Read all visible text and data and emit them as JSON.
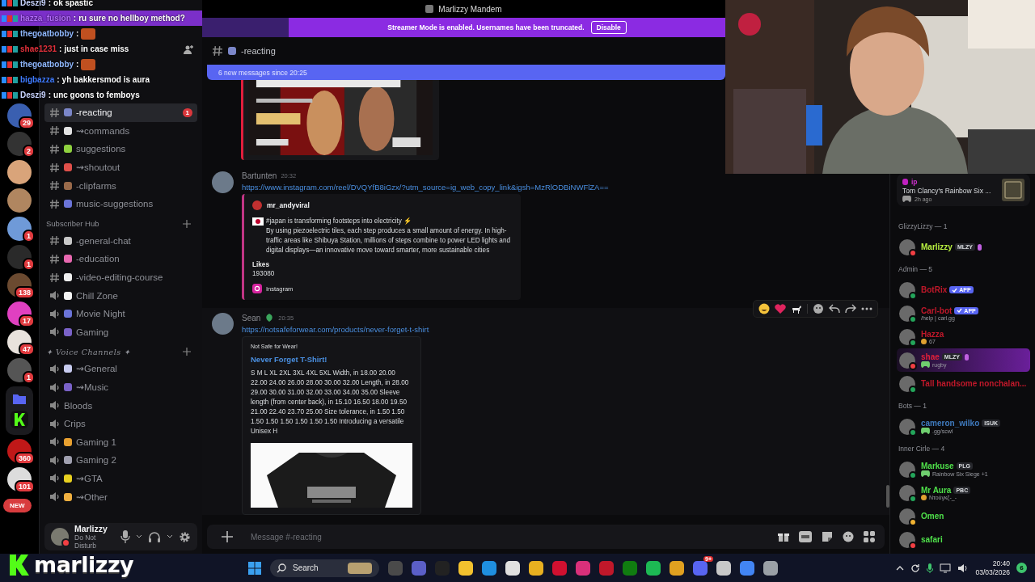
{
  "window": {
    "title": "Marlizzy Mandem"
  },
  "streamer_banner": {
    "text": "Streamer Mode is enabled. Usernames have been truncated.",
    "button": "Disable"
  },
  "stream_chat": [
    {
      "user": "Deszi9",
      "separator": ":",
      "kind": "text",
      "message": "ok spastic",
      "color": "#c9d4ff",
      "highlight": false
    },
    {
      "user": "hazza_fusion",
      "separator": ":",
      "kind": "text",
      "message": "ru sure no hellboy method?",
      "color": "#b46cff",
      "highlight": true
    },
    {
      "user": "thegoatbobby",
      "separator": ":",
      "kind": "emote",
      "color": "#8fb8ff",
      "highlight": false
    },
    {
      "user": "shae1231",
      "separator": ":",
      "kind": "text",
      "message": "just in case miss",
      "color": "#e0303a",
      "highlight": false
    },
    {
      "user": "thegoatbobby",
      "separator": ":",
      "kind": "emote",
      "color": "#8fb8ff",
      "highlight": false
    },
    {
      "user": "bigbazza",
      "separator": ":",
      "kind": "text",
      "message": "yh bakkersmod is aura",
      "color": "#3f7bff",
      "highlight": false
    },
    {
      "user": "Deszi9",
      "separator": ":",
      "kind": "text",
      "message": "unc goons to femboys",
      "color": "#c9d4ff",
      "highlight": false
    }
  ],
  "server_rail": [
    {
      "kind": "server",
      "color": "#3a5fb0",
      "badge": "29"
    },
    {
      "kind": "server",
      "color": "#333333",
      "badge": "2"
    },
    {
      "kind": "server",
      "color": "#d9a47a"
    },
    {
      "kind": "server",
      "color": "#b08660"
    },
    {
      "kind": "server",
      "color": "#6f9ad8",
      "badge": "1"
    },
    {
      "kind": "server",
      "color": "#2a2a2a",
      "badge": "1"
    },
    {
      "kind": "server",
      "color": "#6b4a30",
      "badge": "138"
    },
    {
      "kind": "server",
      "color": "#e040c0",
      "badge": "17"
    },
    {
      "kind": "server",
      "color": "#e8e2dc",
      "badge": "47"
    },
    {
      "kind": "server",
      "color": "#555555",
      "badge": "1"
    },
    {
      "kind": "folder",
      "color": "#5865f2"
    },
    {
      "kind": "server",
      "color": "#c01818",
      "badge": "360"
    },
    {
      "kind": "server",
      "color": "#dcdcdc",
      "badge": "101"
    }
  ],
  "new_badge": "NEW",
  "channel_groups": [
    {
      "channels": [
        {
          "kind": "text",
          "name": "-reacting",
          "color": "#7b86c8",
          "selected": true,
          "badge": "1"
        },
        {
          "kind": "text",
          "name": "⇝commands",
          "color": "#e3e3e3",
          "selected": false
        },
        {
          "kind": "text",
          "name": "suggestions",
          "color": "#8fd13f",
          "selected": false
        },
        {
          "kind": "text",
          "name": "⇝shoutout",
          "color": "#e0504a",
          "selected": false
        },
        {
          "kind": "text",
          "name": "-clipfarms",
          "color": "#9a6a4a",
          "selected": false
        },
        {
          "kind": "text",
          "name": "music-suggestions",
          "color": "#6b74d8",
          "selected": false
        }
      ]
    },
    {
      "title": "Subscriber Hub",
      "channels": [
        {
          "kind": "text",
          "name": "-general-chat",
          "color": "#c8c8c8",
          "selected": false
        },
        {
          "kind": "text",
          "name": "-education",
          "color": "#e868b0",
          "selected": false
        },
        {
          "kind": "text",
          "name": "-video-editing-course",
          "color": "#f0f0f0",
          "selected": false
        },
        {
          "kind": "voice",
          "name": "Chill Zone",
          "color": "#f4f4f4",
          "selected": false
        },
        {
          "kind": "voice",
          "name": "Movie Night",
          "color": "#6b74d8",
          "selected": false
        },
        {
          "kind": "voice",
          "name": "Gaming",
          "color": "#7a62c8",
          "selected": false
        }
      ]
    },
    {
      "title": "✦ Voice Channels ✦",
      "fancy": true,
      "channels": [
        {
          "kind": "voice",
          "name": "⇝General",
          "color": "#c8ccf0",
          "selected": false
        },
        {
          "kind": "voice",
          "name": "⇝Music",
          "color": "#7a62c8",
          "selected": false
        },
        {
          "kind": "voice",
          "name": "Bloods",
          "selected": false
        },
        {
          "kind": "voice",
          "name": "Crips",
          "selected": false
        },
        {
          "kind": "voice",
          "name": "Gaming 1",
          "color": "#e8a030",
          "selected": false
        },
        {
          "kind": "voice",
          "name": "Gaming 2",
          "color": "#a0a0b0",
          "selected": false
        },
        {
          "kind": "voice",
          "name": "⇝GTA",
          "color": "#e8d020",
          "selected": false
        },
        {
          "kind": "voice",
          "name": "⇝Other",
          "color": "#f0b040",
          "selected": false
        }
      ]
    }
  ],
  "user_panel": {
    "name": "Marlizzy",
    "status": "Do Not Disturb"
  },
  "channel_header": {
    "name": "-reacting"
  },
  "new_messages_bar": {
    "text": "6 new messages since 20:25"
  },
  "messages": [
    {
      "kind": "image_embed"
    },
    {
      "kind": "link_embed",
      "author": "Bartunten",
      "time": "20:32",
      "link": "https://www.instagram.com/reel/DVQYfB8iGzx/?utm_source=ig_web_copy_link&igsh=MzRlODBiNWFlZA==",
      "embed": {
        "author": "mr_andyviral",
        "description": "#japan is transforming footsteps into electricity ⚡\nBy using piezoelectric tiles, each step produces a small amount of energy. In high-traffic areas like Shibuya Station, millions of steps combine to power LED lights and digital displays—an innovative move toward smarter, more sustainable cities",
        "field_name": "Likes",
        "field_value": "193080",
        "footer": "Instagram"
      }
    },
    {
      "kind": "product_embed",
      "author": "Sean",
      "time": "20:35",
      "link": "https://notsafeforwear.com/products/never-forget-t-shirt",
      "hovered": true,
      "embed": {
        "provider": "Not Safe for Wear!",
        "title": "Never Forget T-Shirt!",
        "description": "S M L XL 2XL 3XL 4XL 5XL Width, in 18.00 20.00 22.00 24.00 26.00 28.00 30.00 32.00 Length, in 28.00 29.00 30.00 31.00 32.00 33.00 34.00 35.00 Sleeve length (from center back), in 15.10 16.50 18.00 19.50 21.00 22.40 23.70 25.00 Size tolerance, in 1.50 1.50 1.50 1.50 1.50 1.50 1.50 1.50 Introducing a versatile Unisex H"
      }
    }
  ],
  "composer": {
    "placeholder": "Message #-reacting"
  },
  "activity_card": {
    "user": "ip",
    "title": "Tom Clancy's Rainbow Six ...",
    "time": "2h ago"
  },
  "member_groups": [
    {
      "title": "GlizzyLizzy — 1",
      "members": [
        {
          "name": "Marlizzy",
          "color": "#b8f040",
          "status_dot": {
            "kind": "dnd"
          },
          "tag": {
            "kind": "guild",
            "label": "MLZY"
          },
          "boost": true,
          "nameplate": false
        }
      ]
    },
    {
      "title": "Admin — 5",
      "members": [
        {
          "name": "BotRix",
          "color": "#c0182a",
          "status_dot": {
            "kind": "online"
          },
          "tag": {
            "kind": "app",
            "label": "APP"
          },
          "boost": false,
          "nameplate": false
        },
        {
          "name": "Carl-bot",
          "color": "#c0182a",
          "status_dot": {
            "kind": "online"
          },
          "tag": {
            "kind": "app",
            "label": "APP"
          },
          "sub": {
            "kind": "plain",
            "text": "/help | carl.gg"
          },
          "boost": false,
          "nameplate": false
        },
        {
          "name": "Hazza",
          "color": "#c0182a",
          "status_dot": {
            "kind": "online"
          },
          "sub": {
            "kind": "emoji",
            "text": "67"
          },
          "boost": false,
          "nameplate": false
        },
        {
          "name": "shae",
          "color": "#e0203a",
          "status_dot": {
            "kind": "dnd"
          },
          "tag": {
            "kind": "guild",
            "label": "MLZY"
          },
          "sub": {
            "kind": "game",
            "text": "rugby"
          },
          "boost": true,
          "nameplate": true
        },
        {
          "name": "Tall handsome nonchalan...",
          "color": "#c0182a",
          "status_dot": {
            "kind": "online"
          },
          "boost": false,
          "nameplate": false
        }
      ]
    },
    {
      "title": "Bots — 1",
      "members": [
        {
          "name": "cameron_wilko",
          "color": "#3f7bbf",
          "status_dot": {
            "kind": "online"
          },
          "tag": {
            "kind": "guild",
            "label": "ISUK"
          },
          "sub": {
            "kind": "game",
            "text": ".gg/scwl"
          },
          "boost": false,
          "nameplate": false
        }
      ]
    },
    {
      "title": "Inner Cirle — 4",
      "members": [
        {
          "name": "Markuse",
          "color": "#4fe04a",
          "status_dot": {
            "kind": "online"
          },
          "tag": {
            "kind": "guild",
            "label": "PLG"
          },
          "sub": {
            "kind": "game",
            "text": "Rainbow Six Siege +1"
          },
          "boost": false,
          "nameplate": false
        },
        {
          "name": "Mr Aura",
          "color": "#4fe04a",
          "status_dot": {
            "kind": "online"
          },
          "tag": {
            "kind": "guild",
            "label": "PBC"
          },
          "sub": {
            "kind": "emoji",
            "text": "Ντούγκζ-_-"
          },
          "boost": false,
          "nameplate": false
        },
        {
          "name": "Omen",
          "color": "#4fe04a",
          "status_dot": {
            "kind": "idle"
          },
          "boost": false,
          "nameplate": false
        },
        {
          "name": "safari",
          "color": "#4fe04a",
          "status_dot": {
            "kind": "dnd"
          },
          "boost": false,
          "nameplate": false
        }
      ]
    }
  ],
  "overlay_logo": {
    "text": "marlizzy"
  },
  "taskbar": {
    "search": {
      "placeholder": "Search"
    },
    "discord_badge": "9+",
    "time": "20:40",
    "date": "03/03/2026",
    "notifications": "6"
  }
}
